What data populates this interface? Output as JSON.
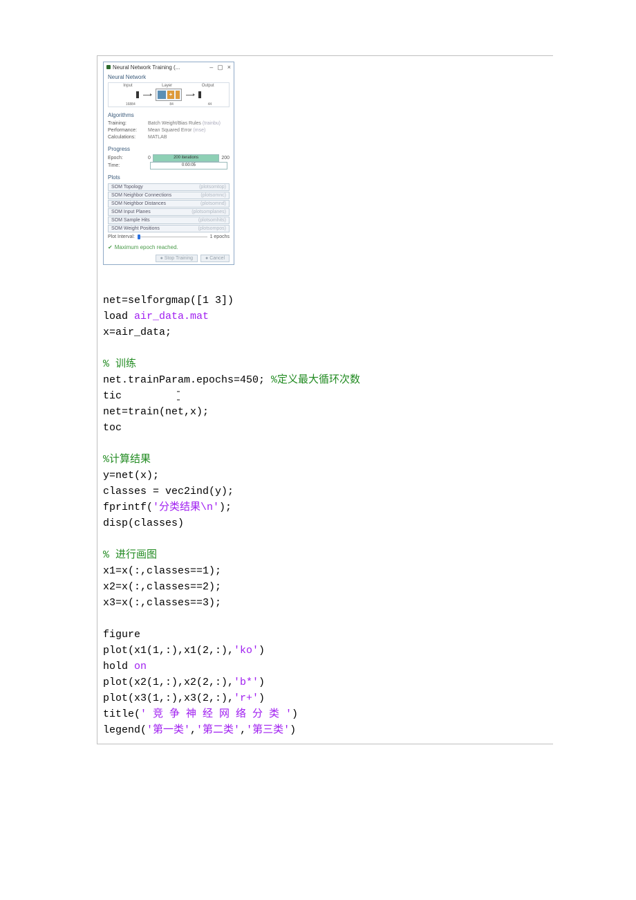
{
  "nn_window": {
    "title": "Neural Network Training (...",
    "controls": {
      "min": "–",
      "max": "▢",
      "close": "×"
    },
    "section_network": "Neural Network",
    "diagram": {
      "input": "Input",
      "layer": "Layer",
      "output": "Output",
      "in_dim": "16884",
      "hid": "84",
      "out": "44"
    },
    "section_algorithms": "Algorithms",
    "alg": {
      "training_k": "Training:",
      "training_v": "Batch Weight/Bias Rules",
      "training_h": "(trainbu)",
      "perf_k": "Performance:",
      "perf_v": "Mean Squared Error",
      "perf_h": "(mse)",
      "calc_k": "Calculations:",
      "calc_v": "MATLAB"
    },
    "section_progress": "Progress",
    "progress": {
      "epoch_k": "Epoch:",
      "epoch_start": "0",
      "epoch_bar": "200 iterations",
      "epoch_end": "200",
      "time_k": "Time:",
      "time_v": "0:00:05"
    },
    "section_plots": "Plots",
    "plot_buttons": [
      {
        "label": "SOM Topology",
        "hint": "(plotsomtop)"
      },
      {
        "label": "SOM Neighbor Connections",
        "hint": "(plotsomnc)"
      },
      {
        "label": "SOM Neighbor Distances",
        "hint": "(plotsomnd)"
      },
      {
        "label": "SOM Input Planes",
        "hint": "(plotsomplanes)"
      },
      {
        "label": "SOM Sample Hits",
        "hint": "(plotsomhits)"
      },
      {
        "label": "SOM Weight Positions",
        "hint": "(plotsompos)"
      }
    ],
    "plot_interval_k": "Plot Interval:",
    "plot_interval_v": "1 epochs",
    "status": "Maximum epoch reached.",
    "btn_stop": "Stop Training",
    "btn_cancel": "Cancel"
  },
  "code": {
    "l1": "net=selforgmap([1 3])",
    "l2a": "load ",
    "l2b": "air_data.mat",
    "l3": "x=air_data;",
    "c_train": "% 训练",
    "l4a": "net.trainParam.epochs=450; ",
    "l4b": "%定义最大循环次数",
    "l5": "tic",
    "l6": "net=train(net,x);",
    "l7": "toc",
    "c_calc": "%计算结果",
    "l8": "y=net(x);",
    "l9": "classes = vec2ind(y);",
    "l10a": "fprintf(",
    "l10b": "'分类结果\\n'",
    "l10c": ");",
    "l11": "disp(classes)",
    "c_plot": "% 进行画图",
    "l12": "x1=x(:,classes==1);",
    "l13": "x2=x(:,classes==2);",
    "l14": "x3=x(:,classes==3);",
    "l15": "figure",
    "l16a": "plot(x1(1,:),x1(2,:),",
    "l16b": "'ko'",
    "l16c": ")",
    "l17a": "hold ",
    "l17b": "on",
    "l18a": "plot(x2(1,:),x2(2,:),",
    "l18b": "'b*'",
    "l18c": ")",
    "l19a": "plot(x3(1,:),x3(2,:),",
    "l19b": "'r+'",
    "l19c": ")",
    "l20a": "title(",
    "l20b": "' 竞 争 神 经 网 络 分 类 '",
    "l20c": ")",
    "l21a": "legend(",
    "l21b": "'第一类'",
    "l21c": ",",
    "l21d": "'第二类'",
    "l21e": ",",
    "l21f": "'第三类'",
    "l21g": ")"
  }
}
